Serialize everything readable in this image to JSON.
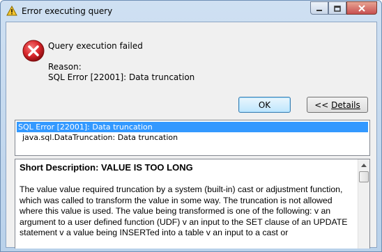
{
  "window": {
    "title": "Error executing query",
    "controls": [
      "minimize",
      "maximize",
      "close"
    ]
  },
  "message": {
    "headline": "Query execution failed",
    "reason_label": "Reason:",
    "reason_text": "SQL Error [22001]: Data truncation"
  },
  "buttons": {
    "ok_label": "OK",
    "details_prefix": "<< ",
    "details_label": "Details"
  },
  "errors_list": [
    "SQL Error [22001]: Data truncation",
    "java.sql.DataTruncation: Data truncation"
  ],
  "description": {
    "title": "Short Description: VALUE IS TOO LONG",
    "body": "The value value required truncation by a system (built-in) cast or adjustment function, which was called to transform the value in some way. The truncation is not allowed where this value is used. The value being transformed is one of the following: v an argument to a user defined function (UDF) v an input to the SET clause of an UPDATE statement v a value being INSERTed into a table v an input to a cast or"
  },
  "icons": {
    "error": "error-icon",
    "title": "database-warning-icon"
  },
  "colors": {
    "selection": "#3399ff",
    "error_red": "#d9262b",
    "close_button": "#c75050"
  }
}
